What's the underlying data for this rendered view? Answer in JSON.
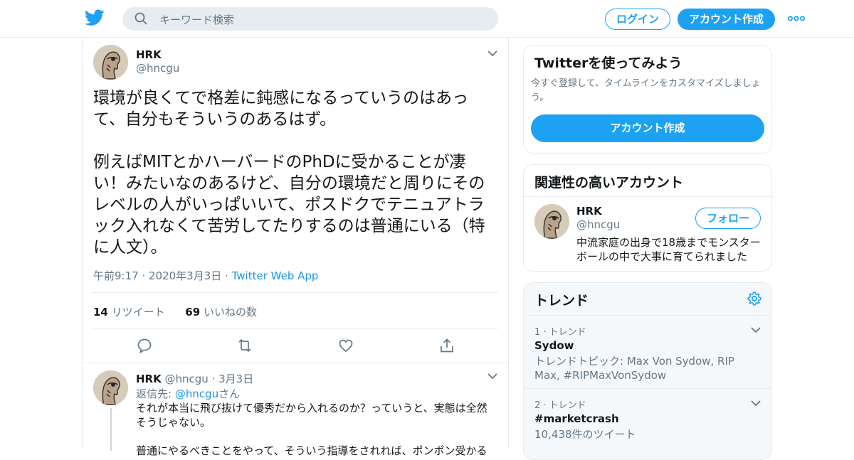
{
  "header": {
    "logo": "twitter-bird-icon",
    "search_placeholder": "キーワード検索",
    "login_label": "ログイン",
    "signup_label": "アカウント作成",
    "more_icon": "more-dots-icon",
    "accent_color": "#1da1f2"
  },
  "tweet": {
    "name": "HRK",
    "handle": "@hncgu",
    "text": "環境が良くてで格差に鈍感になるっていうのはあって、自分もそういうのあるはず。\n\n例えばMITとかハーバードのPhDに受かることが凄い！みたいなのあるけど、自分の環境だと周りにそのレベルの人がいっぱいいて、ポスドクでテニュアトラック入れなくて苦労してたりするのは普通にいる（特に人文）。",
    "time": "午前9:17 · 2020年3月3日",
    "separator": "·",
    "app": "Twitter Web App",
    "retweet_count": "14",
    "retweet_label": "リツイート",
    "like_count": "69",
    "like_label": "いいねの数",
    "actions": [
      "reply-icon",
      "retweet-icon",
      "like-icon",
      "share-icon"
    ]
  },
  "reply": {
    "name": "HRK",
    "handle": "@hncgu",
    "date": "· 3月3日",
    "reply_to_prefix": "返信先:",
    "reply_to_handle": "@hncgu",
    "reply_to_suffix": "さん",
    "text": "それが本当に飛び抜けて優秀だから入れるのか？っていうと、実態は全然そうじゃない。\n\n普通にやるべきことをやって、そういう指導をされれば、ポンポン受かる"
  },
  "signup_card": {
    "title": "Twitterを使ってみよう",
    "description": "今すぐ登録して、タイムラインをカスタマイズしましょう。",
    "button_label": "アカウント作成"
  },
  "related_card": {
    "title": "関連性の高いアカウント",
    "name": "HRK",
    "handle": "@hncgu",
    "follow_label": "フォロー",
    "bio": "中流家庭の出身で18歳までモンスターボールの中で大事に育てられました"
  },
  "trends_card": {
    "title": "トレンド",
    "settings_icon": "gear-icon",
    "items": [
      {
        "meta": "1 · トレンド",
        "name": "Sydow",
        "description": "トレンドトピック: Max Von Sydow, RIP Max, #RIPMaxVonSydow"
      },
      {
        "meta": "2 · トレンド",
        "name": "#marketcrash",
        "description": "10,438件のツイート"
      }
    ]
  }
}
